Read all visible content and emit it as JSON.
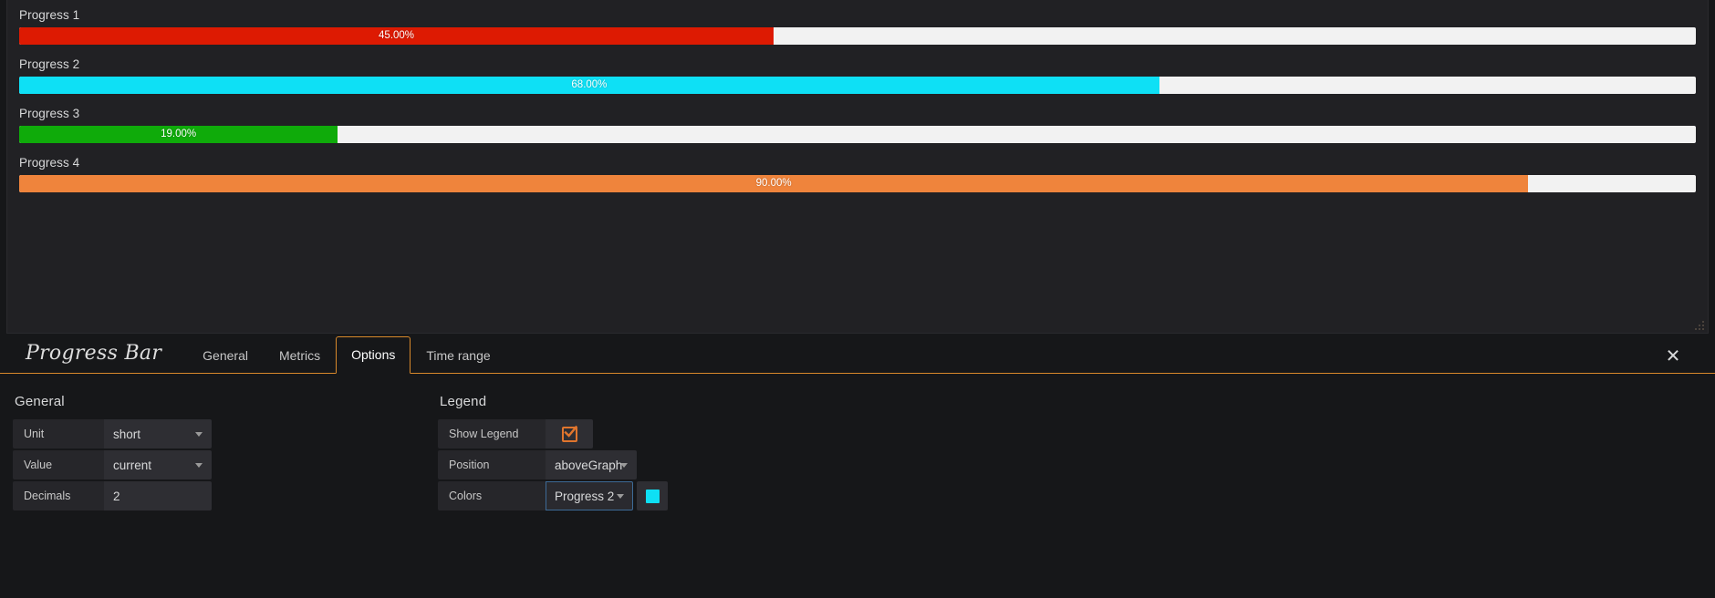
{
  "graph_panel": {
    "bars": [
      {
        "label": "Progress 1",
        "value_text": "45.00%",
        "percent": 45,
        "color": "#dd1a02"
      },
      {
        "label": "Progress 2",
        "value_text": "68.00%",
        "percent": 68,
        "color": "#0ee0f5"
      },
      {
        "label": "Progress 3",
        "value_text": "19.00%",
        "percent": 19,
        "color": "#0fab0a"
      },
      {
        "label": "Progress 4",
        "value_text": "90.00%",
        "percent": 90,
        "color": "#ef843c"
      }
    ],
    "track_color": "#f2f2f2",
    "resize_grip_icon": "resize-grip-icon"
  },
  "editor": {
    "title": "Progress Bar",
    "tabs": [
      {
        "label": "General",
        "active": false
      },
      {
        "label": "Metrics",
        "active": false
      },
      {
        "label": "Options",
        "active": true
      },
      {
        "label": "Time range",
        "active": false
      }
    ],
    "close_icon": "close-icon",
    "accent_color": "#d8892b",
    "sections": {
      "general": {
        "title": "General",
        "rows": [
          {
            "label": "Unit",
            "value": "short",
            "control": "select"
          },
          {
            "label": "Value",
            "value": "current",
            "control": "select"
          },
          {
            "label": "Decimals",
            "value": "2",
            "control": "input"
          }
        ]
      },
      "legend": {
        "title": "Legend",
        "show_legend": {
          "label": "Show Legend",
          "checked": true,
          "check_color": "#e0752d"
        },
        "position": {
          "label": "Position",
          "value": "aboveGraph"
        },
        "colors": {
          "label": "Colors",
          "value": "Progress 2",
          "swatch_color": "#0ee0f5"
        }
      }
    }
  }
}
